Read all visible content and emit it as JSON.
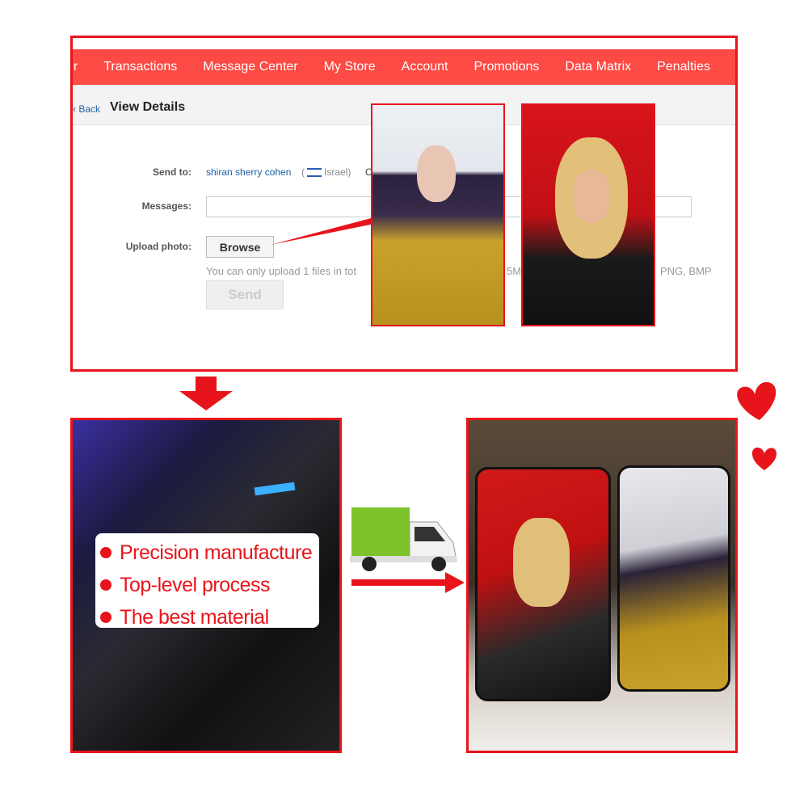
{
  "nav": {
    "items": [
      "er",
      "Transactions",
      "Message Center",
      "My Store",
      "Account",
      "Promotions",
      "Data Matrix",
      "Penalties"
    ]
  },
  "header": {
    "back_label": "‹ Back",
    "title": "View Details"
  },
  "form": {
    "send_to_label": "Send to:",
    "recipient_name": "shiran sherry cohen",
    "recipient_country": "Israel",
    "extra_text": "O",
    "messages_label": "Messages:",
    "messages_value": "",
    "upload_label": "Upload photo:",
    "browse_label": "Browse",
    "hint_left": "You can only upload 1 files in tot",
    "hint_mid": "5M",
    "hint_right": "PNG, BMP",
    "send_label": "Send"
  },
  "features": [
    "Precision manufacture",
    "Top-level process",
    "The best material"
  ],
  "colors": {
    "accent": "#e8141b",
    "nav": "#fd4a44",
    "link": "#1a5fa8"
  }
}
